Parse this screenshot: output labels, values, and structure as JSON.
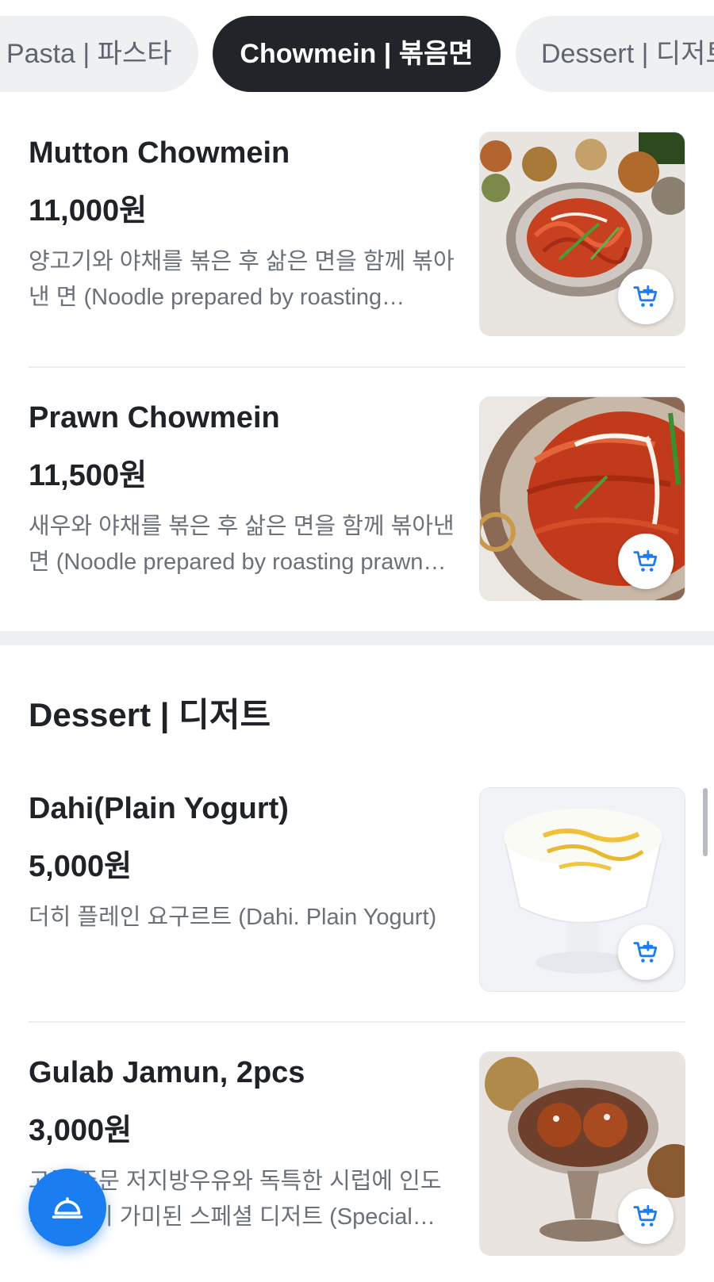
{
  "tabs": [
    {
      "label": "Pasta | 파스타",
      "active": false
    },
    {
      "label": "Chowmein | 볶음면",
      "active": true
    },
    {
      "label": "Dessert | 디저트",
      "active": false
    }
  ],
  "items": [
    {
      "name": "Mutton Chowmein",
      "price": "11,000원",
      "description": "양고기와 야채를 볶은 후 삶은 면을 함께 볶아낸 면 (Noodle prepared by roasting mutton and vegetables)"
    },
    {
      "name": "Prawn Chowmein",
      "price": "11,500원",
      "description": "새우와 야채를 볶은 후 삶은 면을 함께 볶아낸 면 (Noodle prepared by roasting prawn and vegetables)"
    }
  ],
  "dessert_section": {
    "title": "Dessert | 디저트",
    "items": [
      {
        "name": "Dahi(Plain Yogurt)",
        "price": "5,000원",
        "description": "더히 플레인 요구르트 (Dahi. Plain Yogurt)"
      },
      {
        "name": "Gulab Jamun, 2pcs",
        "price": "3,000원",
        "description": "고급 주문 저지방우유와 독특한 시럽에 인도 치즈볼이 가미된 스페셜 디저트 (Special dessert)"
      }
    ]
  },
  "icons": {
    "cart": "add-to-cart-icon",
    "fab": "service-bell-icon"
  },
  "colors": {
    "accent": "#1a7df0",
    "active_tab_bg": "#212529",
    "inactive_tab_bg": "#eef0f2"
  }
}
